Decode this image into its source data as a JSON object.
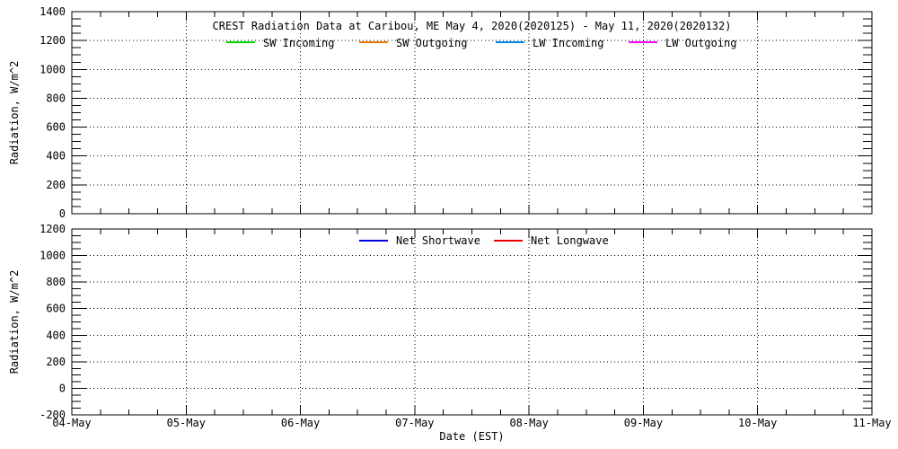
{
  "figure_title": "CREST Radiation Data at Caribou, ME   May  4, 2020(2020125) - May 11, 2020(2020132)",
  "chart_data": [
    {
      "type": "line",
      "title": "CREST Radiation Data at Caribou, ME   May  4, 2020(2020125) - May 11, 2020(2020132)",
      "ylabel": "Radiation, W/m^2",
      "xlabel": "",
      "ylim": [
        0,
        1400
      ],
      "ytick_step": 200,
      "ytick_labels": [
        "0",
        "200",
        "400",
        "600",
        "800",
        "1000",
        "1200",
        "1400"
      ],
      "y_minor_divisions": 4,
      "x_categories": [
        "04-May",
        "05-May",
        "06-May",
        "07-May",
        "08-May",
        "09-May",
        "10-May",
        "11-May"
      ],
      "x_minor_divisions": 4,
      "show_x_tick_labels": false,
      "grid": "dotted",
      "legend_position": "inside-top",
      "series": [
        {
          "name": "SW Incoming",
          "color": "#00dd00",
          "values": []
        },
        {
          "name": "SW Outgoing",
          "color": "#ee7700",
          "values": []
        },
        {
          "name": "LW Incoming",
          "color": "#0088ee",
          "values": []
        },
        {
          "name": "LW Outgoing",
          "color": "#ff00ff",
          "values": []
        }
      ]
    },
    {
      "type": "line",
      "title": "",
      "ylabel": "Radiation, W/m^2",
      "xlabel": "Date (EST)",
      "ylim": [
        -200,
        1200
      ],
      "ytick_step": 200,
      "ytick_labels": [
        "-200",
        "0",
        "200",
        "400",
        "600",
        "800",
        "1000",
        "1200"
      ],
      "y_minor_divisions": 4,
      "x_categories": [
        "04-May",
        "05-May",
        "06-May",
        "07-May",
        "08-May",
        "09-May",
        "10-May",
        "11-May"
      ],
      "x_minor_divisions": 4,
      "show_x_tick_labels": true,
      "grid": "dotted",
      "legend_position": "inside-top",
      "series": [
        {
          "name": "Net Shortwave",
          "color": "#0000dd",
          "values": []
        },
        {
          "name": "Net Longwave",
          "color": "#ee0000",
          "values": []
        }
      ]
    }
  ]
}
